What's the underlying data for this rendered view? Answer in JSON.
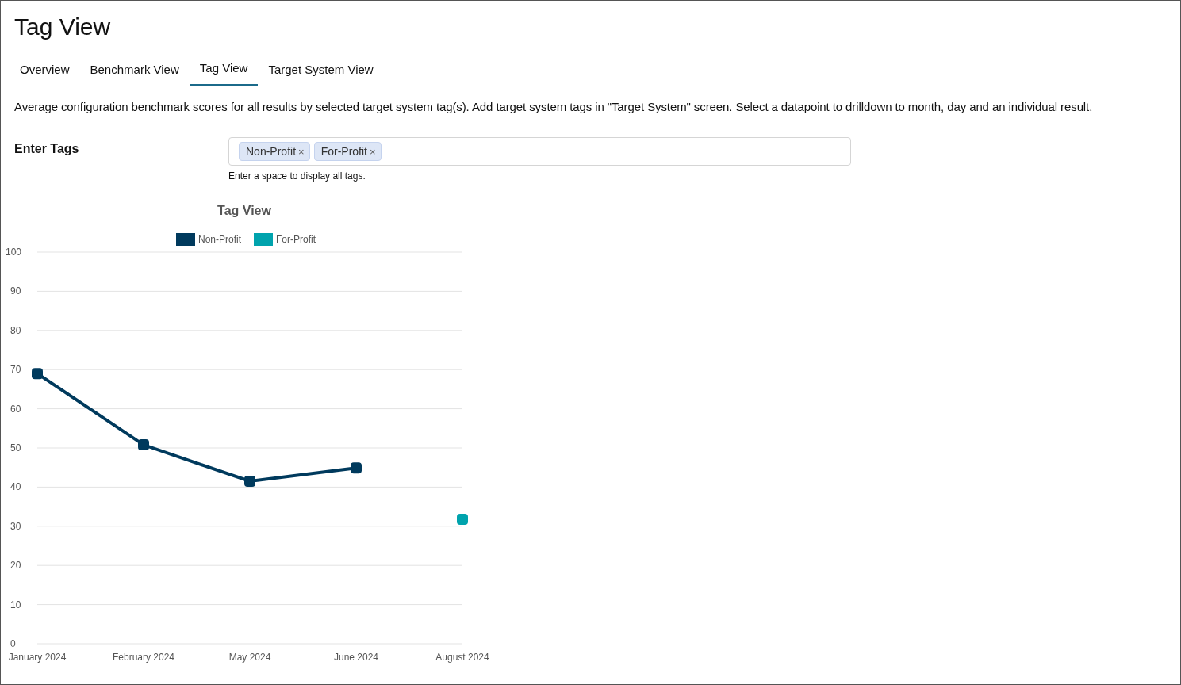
{
  "page_title": "Tag View",
  "tabs": [
    {
      "label": "Overview",
      "selected": false
    },
    {
      "label": "Benchmark View",
      "selected": false
    },
    {
      "label": "Tag View",
      "selected": true
    },
    {
      "label": "Target System View",
      "selected": false
    }
  ],
  "description": "Average configuration benchmark scores for all results by selected target system tag(s). Add target system tags in \"Target System\" screen. Select a datapoint to drilldown to month, day and an individual result.",
  "tag_input": {
    "label": "Enter Tags",
    "tags": [
      {
        "text": "Non-Profit",
        "remove": "×"
      },
      {
        "text": "For-Profit",
        "remove": "×"
      }
    ],
    "hint": "Enter a space to display all tags."
  },
  "chart": {
    "chart_data": {
      "type": "line",
      "title": "Tag View",
      "categories": [
        "January 2024",
        "February 2024",
        "May 2024",
        "June 2024",
        "August 2024"
      ],
      "series": [
        {
          "name": "Non-Profit",
          "color": "#003a5d",
          "marker": "square",
          "values": [
            69.0,
            50.8,
            41.5,
            44.9,
            null
          ]
        },
        {
          "name": "For-Profit",
          "color": "#00a3ad",
          "marker": "square",
          "values": [
            null,
            null,
            null,
            null,
            31.8
          ]
        }
      ],
      "grid": true,
      "legend": true,
      "ylim": [
        0,
        100
      ],
      "yticks": [
        0,
        10,
        20,
        30,
        40,
        50,
        60,
        70,
        80,
        90,
        100
      ]
    }
  }
}
